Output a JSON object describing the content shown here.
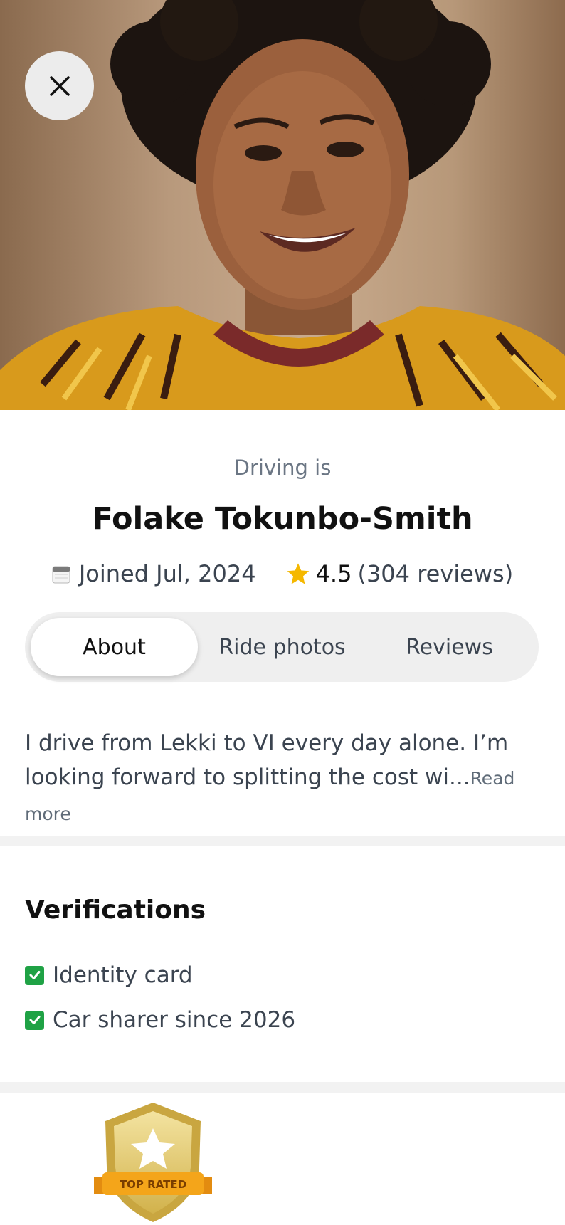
{
  "profile": {
    "tagline": "Driving is",
    "name": "Folake Tokunbo-Smith",
    "joined": "Joined Jul, 2024",
    "rating": "4.5",
    "reviews": "(304 reviews)"
  },
  "icons": {
    "close": "close-icon",
    "calendar": "calendar-icon",
    "star": "star-icon",
    "check": "check-icon"
  },
  "tabs": [
    {
      "label": "About",
      "active": true
    },
    {
      "label": "Ride photos",
      "active": false
    },
    {
      "label": "Reviews",
      "active": false
    }
  ],
  "about": {
    "text": "I drive from Lekki to VI every day alone. I’m looking forward to splitting the cost wi...",
    "read_more": "Read more"
  },
  "verifications": {
    "title": "Verifications",
    "items": [
      "Identity card",
      "Car sharer since 2026"
    ]
  },
  "badge": {
    "label": "TOP RATED"
  },
  "colors": {
    "star": "#f5b800",
    "check": "#1fa245",
    "tab_bg": "#efefef",
    "muted_text": "#6b7684"
  }
}
